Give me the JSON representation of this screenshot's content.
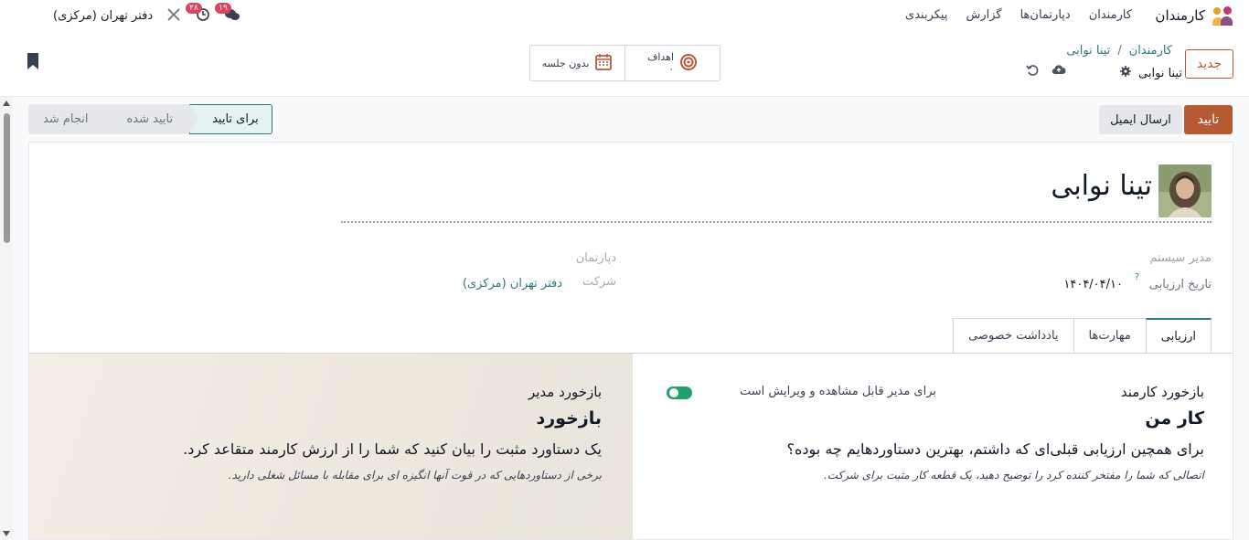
{
  "navbar": {
    "app_name": "کارمندان",
    "menu": [
      "کارمندان",
      "دپارتمان‌ها",
      "گزارش",
      "پیکربندی"
    ],
    "messages_count": "۱۹",
    "activities_count": "۲۸",
    "company": "دفتر تهران (مرکزی)"
  },
  "control_panel": {
    "new_label": "جدید",
    "breadcrumb": [
      "کارمندان",
      "تینا نوابی"
    ],
    "record_title": "تینا نوابی",
    "goals_label": "اهداف",
    "goals_count": "۰",
    "meeting_label": "بدون جلسه"
  },
  "statusbar": {
    "approve_label": "تایید",
    "email_label": "ارسال ایمیل",
    "stages": [
      "برای تایید",
      "تایید شده",
      "انجام شد"
    ],
    "active_stage": "برای تایید"
  },
  "form": {
    "employee_name": "تینا نوابی",
    "manager": "مدیر سیستم",
    "eval_date_label": "تاریخ ارزیابی",
    "eval_date_help": "?",
    "eval_date": "۱۴۰۴/۰۴/۱۰",
    "department_label": "دپارتمان",
    "company_label": "شرکت",
    "company": "دفتر تهران (مرکزی)",
    "tabs": [
      "ارزیابی",
      "مهارت‌ها",
      "یادداشت خصوصی"
    ],
    "employee_feedback": {
      "heading": "بازخورد کارمند",
      "toggle_label": "برای مدیر قابل مشاهده و ویرایش است",
      "toggle_on": true,
      "title": "کار من",
      "question": "برای همچین ارزیابی قبلی‌ای که داشتم، بهترین دستاوردهایم چه بوده؟",
      "hint": "اتصالی که شما را مفتخر کننده کرد را توضیح دهید، یک قطعه کار مثبت برای شرکت."
    },
    "manager_feedback": {
      "heading": "بازخورد مدیر",
      "title": "بازخورد",
      "question": "یک دستاورد مثبت را بیان کنید که شما را از ارزش کارمند متقاعد کرد.",
      "hint": "برخی از دستاوردهایی که در قوت آنها انگیزه ای برای مقابله با مسائل شغلی دارید."
    }
  },
  "colors": {
    "primary": "#b55a33",
    "link": "#2b7a7a",
    "toggle": "#22a06b",
    "badge": "#d9455f"
  }
}
